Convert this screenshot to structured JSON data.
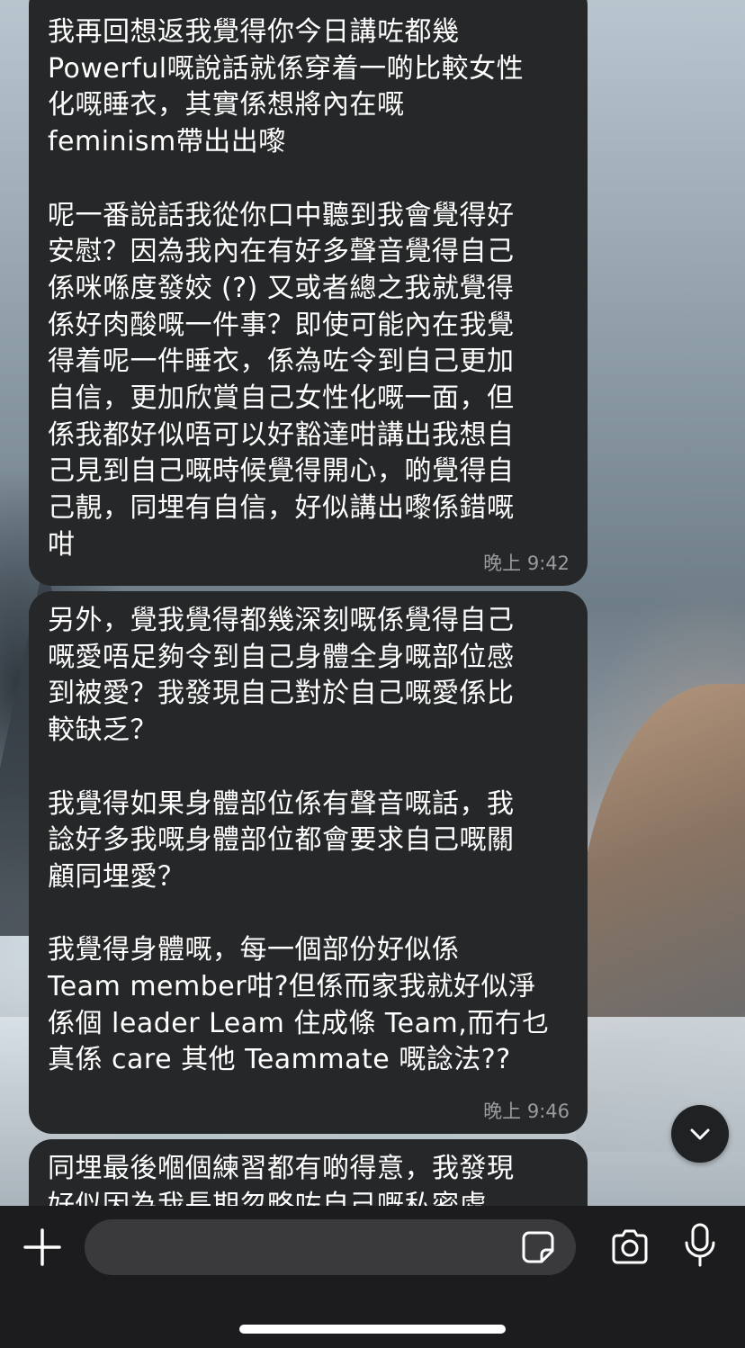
{
  "messages": [
    {
      "text": "我再回想返我覺得你今日講咗都幾\nPowerful嘅說話就係穿着一啲比較女性\n化嘅睡衣，其實係想將內在嘅\nfeminism帶出出嚟\n\n呢一番說話我從你口中聽到我會覺得好\n安慰？因為我內在有好多聲音覺得自己\n係咪喺度發姣 (?) 又或者總之我就覺得\n係好肉酸嘅一件事？即使可能內在我覺\n得着呢一件睡衣，係為咗令到自己更加\n自信，更加欣賞自己女性化嘅一面，但\n係我都好似唔可以好豁達咁講出我想自\n己見到自己嘅時候覺得開心，啲覺得自\n己靚，同埋有自信，好似講出嚟係錯嘅\n咁",
      "time": "晚上 9:42"
    },
    {
      "text": "另外，覺我覺得都幾深刻嘅係覺得自己\n嘅愛唔足夠令到自己身體全身嘅部位感\n到被愛？我發現自己對於自己嘅愛係比\n較缺乏？\n\n我覺得如果身體部位係有聲音嘅話，我\n諗好多我嘅身體部位都會要求自己嘅關\n顧同埋愛？\n\n我覺得身體嘅，每一個部份好似係\nTeam member咁?但係而家我就好似淨\n係個 leader Leam 住成條 Team,而冇乜\n真係 care 其他 Teammate 嘅諗法??",
      "time": "晚上 9:46"
    },
    {
      "text": "同埋最後嗰個練習都有啲得意，我發現\n好似因為我長期忽略咗自己嘅私密處，",
      "time": ""
    }
  ],
  "input": {
    "value": "",
    "placeholder": ""
  },
  "icons": {
    "add": "plus-icon",
    "sticker": "sticker-icon",
    "camera": "camera-icon",
    "mic": "microphone-icon",
    "scroll": "chevron-down-icon"
  },
  "colors": {
    "bubble": "#262728",
    "input_bar": "#1c1c1e",
    "text_field": "#3a3a3c",
    "timestamp": "#9a9b9d"
  }
}
